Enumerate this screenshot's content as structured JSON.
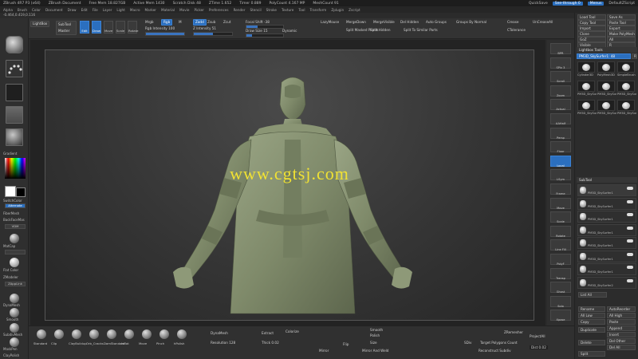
{
  "title_bar": {
    "app": "ZBrush 4R7 P3 (x64)",
    "document": "ZBrush Document",
    "free_mem": "Free Mem 18.827GB",
    "active_mem": "Active Mem 1430",
    "scratch_disk": "Scratch Disk 48",
    "ztime": "ZTime 1.652",
    "timer": "Timer 0.889",
    "poly_count": "PolyCount 4.167 MP",
    "mesh_count": "MeshCount 91",
    "quicksave": "QuickSave",
    "see_through": "See-through 0",
    "menus": "Menus",
    "default_script": "DefaultZScript"
  },
  "menu_bar": [
    "Alpha",
    "Brush",
    "Color",
    "Document",
    "Draw",
    "Edit",
    "File",
    "Layer",
    "Light",
    "Macro",
    "Marker",
    "Material",
    "Movie",
    "Picker",
    "Preferences",
    "Render",
    "Stencil",
    "Stroke",
    "Texture",
    "Tool",
    "Transform",
    "Zplugin",
    "Zscript"
  ],
  "coords": "-0.464,0.419,0.116",
  "top_toolbar": {
    "lightbox": "LightBox",
    "subtool_master": "SubTool Master",
    "modes": [
      {
        "label": "Edit",
        "active": true
      },
      {
        "label": "Draw",
        "active": true
      },
      {
        "label": "Move",
        "active": false
      },
      {
        "label": "Scale",
        "active": false
      },
      {
        "label": "Rotate",
        "active": false
      }
    ],
    "mrgb": "Mrgb",
    "rgb": "Rgb",
    "m": "M",
    "zadd": "Zadd",
    "zsub": "Zsub",
    "zcut": "Zcut",
    "rgb_intensity": "Rgb Intensity 100",
    "z_intensity": "Z Intensity 51",
    "focal_shift": "Focal Shift -38",
    "draw_size": "Draw Size 15",
    "dynamic": "Dynamic",
    "lazymouse": "LazyMouse",
    "mergedown": "MergeDown",
    "mergevisible": "MergeVisible",
    "del_hidden": "Del Hidden",
    "auto_groups": "Auto Groups",
    "groups_by_normal": "Groups By Normal",
    "split_hidden": "Split Hidden",
    "split_masked_points": "Split Masked Points",
    "split_to_similar": "Split To Similar Parts",
    "crease": "Crease",
    "uncrease_all": "UnCreaseAll",
    "ctolerance": "CTolerance",
    "rgb_intensity_fraction": 1.0,
    "z_intensity_fraction": 0.51,
    "focal_shift_fraction": 0.31,
    "draw_size_fraction": 0.15
  },
  "left_tray": {
    "gradient": "Gradient",
    "switch_color": "SwitchColor",
    "alternate": "Alternate",
    "fibermesh": "FiberMesh",
    "backface": "BackFaceMas",
    "vdm": "VDM",
    "matcap": "MatCap",
    "flat_color": "Flat Color",
    "zmodeler": "ZModeler",
    "zapplink": "ZAppLink",
    "dynamesh": "DynaMesh",
    "smooth": "Smooth",
    "subdiv": "SubdivMesh",
    "mask": "MaskPen",
    "clay_polish": "ClayPolish",
    "accent_color": "#2b6fbf"
  },
  "viewport": {
    "watermark": "www.cgtsj.com",
    "model_color": "#7f8a6a",
    "background_top": "#4a4a4a",
    "background_bottom": "#262626"
  },
  "right_strip": [
    "BPR",
    "SPix 3",
    "Scroll",
    "Zoom",
    "Actual",
    "AAHalf",
    "Persp",
    "Floor",
    "Local",
    "LSym",
    "Frame",
    "Move",
    "Scale",
    "Rotate",
    "Line Fill",
    "PolyF",
    "Transp",
    "Ghost",
    "Solo",
    "Xpose"
  ],
  "right_panel": {
    "tool_buttons": [
      "Load Tool",
      "Save As",
      "Copy Tool",
      "Paste Tool",
      "Import",
      "Export",
      "Clone",
      "Make PolyMesh3D",
      "GoZ",
      "All",
      "Visible",
      "R"
    ],
    "lightbox_tools": "Lightbox Tools",
    "current_tool": "PM3D_SkySurfer1: 48",
    "r_label": "R",
    "tool_thumbs": [
      "Cylinder3D",
      "PolyMesh3D",
      "SimpleBrush",
      "PM3D_SkySurfer1",
      "PM3D_SkySurfer1",
      "PM3D_SkySurfer1",
      "PM3D_SkySurfer1",
      "PM3D_SkySurfer1",
      "PM3D_SkySurfer1"
    ],
    "subtool": "SubTool",
    "subtool_items": [
      "PM3D_SkySurfer1",
      "PM3D_SkySurfer1",
      "PM3D_SkySurfer1",
      "PM3D_SkySurfer1",
      "PM3D_SkySurfer1",
      "PM3D_SkySurfer1",
      "PM3D_SkySurfer1",
      "PM3D_SkySurfer2"
    ],
    "list_all": "List All",
    "rename": "Rename",
    "auto_reorder": "AutoReorder",
    "all_low": "All Low",
    "all_high": "All High",
    "copy": "Copy",
    "paste": "Paste",
    "duplicate": "Duplicate",
    "append": "Append",
    "insert": "Insert",
    "delete": "Delete",
    "del_other": "Del Other",
    "del_all": "Del All",
    "split": "Split"
  },
  "bottom_shelf": {
    "brushes": [
      "Standard",
      "Clip",
      "ClayBuildup",
      "Orb_Cracks",
      "DamStandard",
      "Inflat",
      "Move",
      "Pinch",
      "hPolish",
      "Orb_Flatten",
      "Magnify",
      "Trim",
      "TrimDynamic",
      "Smooth",
      "Snakehook",
      "ZModeler",
      "ZRemesh",
      "IMM_Primitive",
      "Clay"
    ],
    "dynamesh": "DynaMesh",
    "resolution": "Resolution 128",
    "extract": "Extract",
    "thick": "Thick 0.02",
    "colorize": "Colorize",
    "mirror": "Mirror",
    "mirror_weld": "Mirror And Weld",
    "smooth": "Smooth",
    "polish": "Polish",
    "zremesher": "ZRemesher",
    "target_polygons": "Target Polygons Count",
    "reconstruct_subdiv": "Reconstruct Subdiv",
    "projectall": "ProjectAll",
    "dist": "Dist 0.02",
    "flip": "Flip",
    "sdiv": "SDiv",
    "size": "Size"
  }
}
